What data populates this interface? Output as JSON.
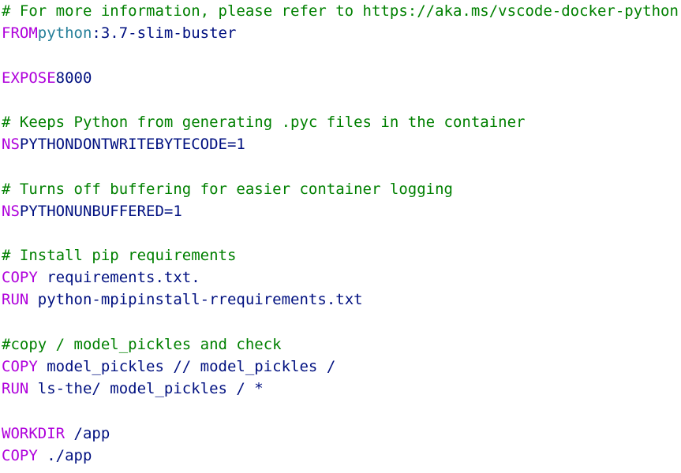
{
  "editor": {
    "lines": [
      {
        "tokens": [
          {
            "type": "comment",
            "text": "# For more information, please refer to https://aka.ms/vscode-docker-python"
          }
        ]
      },
      {
        "tokens": [
          {
            "type": "keyword",
            "text": "FROM"
          },
          {
            "type": "image",
            "text": "python"
          },
          {
            "type": "plain",
            "text": ":3.7-slim-buster"
          }
        ]
      },
      {
        "tokens": []
      },
      {
        "tokens": [
          {
            "type": "keyword",
            "text": "EXPOSE"
          },
          {
            "type": "plain",
            "text": "8000"
          }
        ]
      },
      {
        "tokens": []
      },
      {
        "tokens": [
          {
            "type": "comment",
            "text": "# Keeps Python from generating .pyc files in the container"
          }
        ]
      },
      {
        "tokens": [
          {
            "type": "keyword",
            "text": "NS"
          },
          {
            "type": "plain",
            "text": "PYTHONDONTWRITEBYTECODE=1"
          }
        ]
      },
      {
        "tokens": []
      },
      {
        "tokens": [
          {
            "type": "comment",
            "text": "# Turns off buffering for easier container logging"
          }
        ]
      },
      {
        "tokens": [
          {
            "type": "keyword",
            "text": "NS"
          },
          {
            "type": "plain",
            "text": "PYTHONUNBUFFERED=1"
          }
        ]
      },
      {
        "tokens": []
      },
      {
        "tokens": [
          {
            "type": "comment",
            "text": "# Install pip requirements"
          }
        ]
      },
      {
        "tokens": [
          {
            "type": "keyword",
            "text": "COPY"
          },
          {
            "type": "plain",
            "text": " requirements.txt."
          }
        ]
      },
      {
        "tokens": [
          {
            "type": "keyword",
            "text": "RUN"
          },
          {
            "type": "plain",
            "text": " python-mpipinstall-rrequirements.txt"
          }
        ]
      },
      {
        "tokens": []
      },
      {
        "tokens": [
          {
            "type": "comment",
            "text": "#copy / model_pickles and check"
          }
        ]
      },
      {
        "tokens": [
          {
            "type": "keyword",
            "text": "COPY"
          },
          {
            "type": "plain",
            "text": " model_pickles // model_pickles /"
          }
        ]
      },
      {
        "tokens": [
          {
            "type": "keyword",
            "text": "RUN"
          },
          {
            "type": "plain",
            "text": " ls-the/ model_pickles / *"
          }
        ]
      },
      {
        "tokens": []
      },
      {
        "tokens": [
          {
            "type": "keyword",
            "text": "WORKDIR"
          },
          {
            "type": "plain",
            "text": " /app"
          }
        ]
      },
      {
        "tokens": [
          {
            "type": "keyword",
            "text": "COPY"
          },
          {
            "type": "plain",
            "text": " ./app"
          }
        ]
      }
    ]
  },
  "colors": {
    "background": "#ffffff",
    "comment": "#008000",
    "keyword": "#af00db",
    "image": "#267f99",
    "plain": "#001080"
  }
}
